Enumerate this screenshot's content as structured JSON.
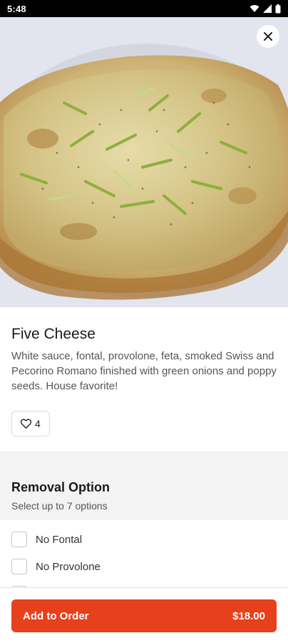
{
  "status_bar": {
    "time": "5:48"
  },
  "item": {
    "title": "Five Cheese",
    "description": "White sauce, fontal, provolone, feta, smoked Swiss and Pecorino Romano finished with green onions and poppy seeds. House favorite!",
    "likes": "4"
  },
  "removal": {
    "title": "Removal Option",
    "subtitle": "Select up to 7 options",
    "options": [
      "No Fontal",
      "No Provolone"
    ]
  },
  "footer": {
    "add_label": "Add to Order",
    "price": "$18.00"
  },
  "colors": {
    "accent": "#e6401c"
  }
}
